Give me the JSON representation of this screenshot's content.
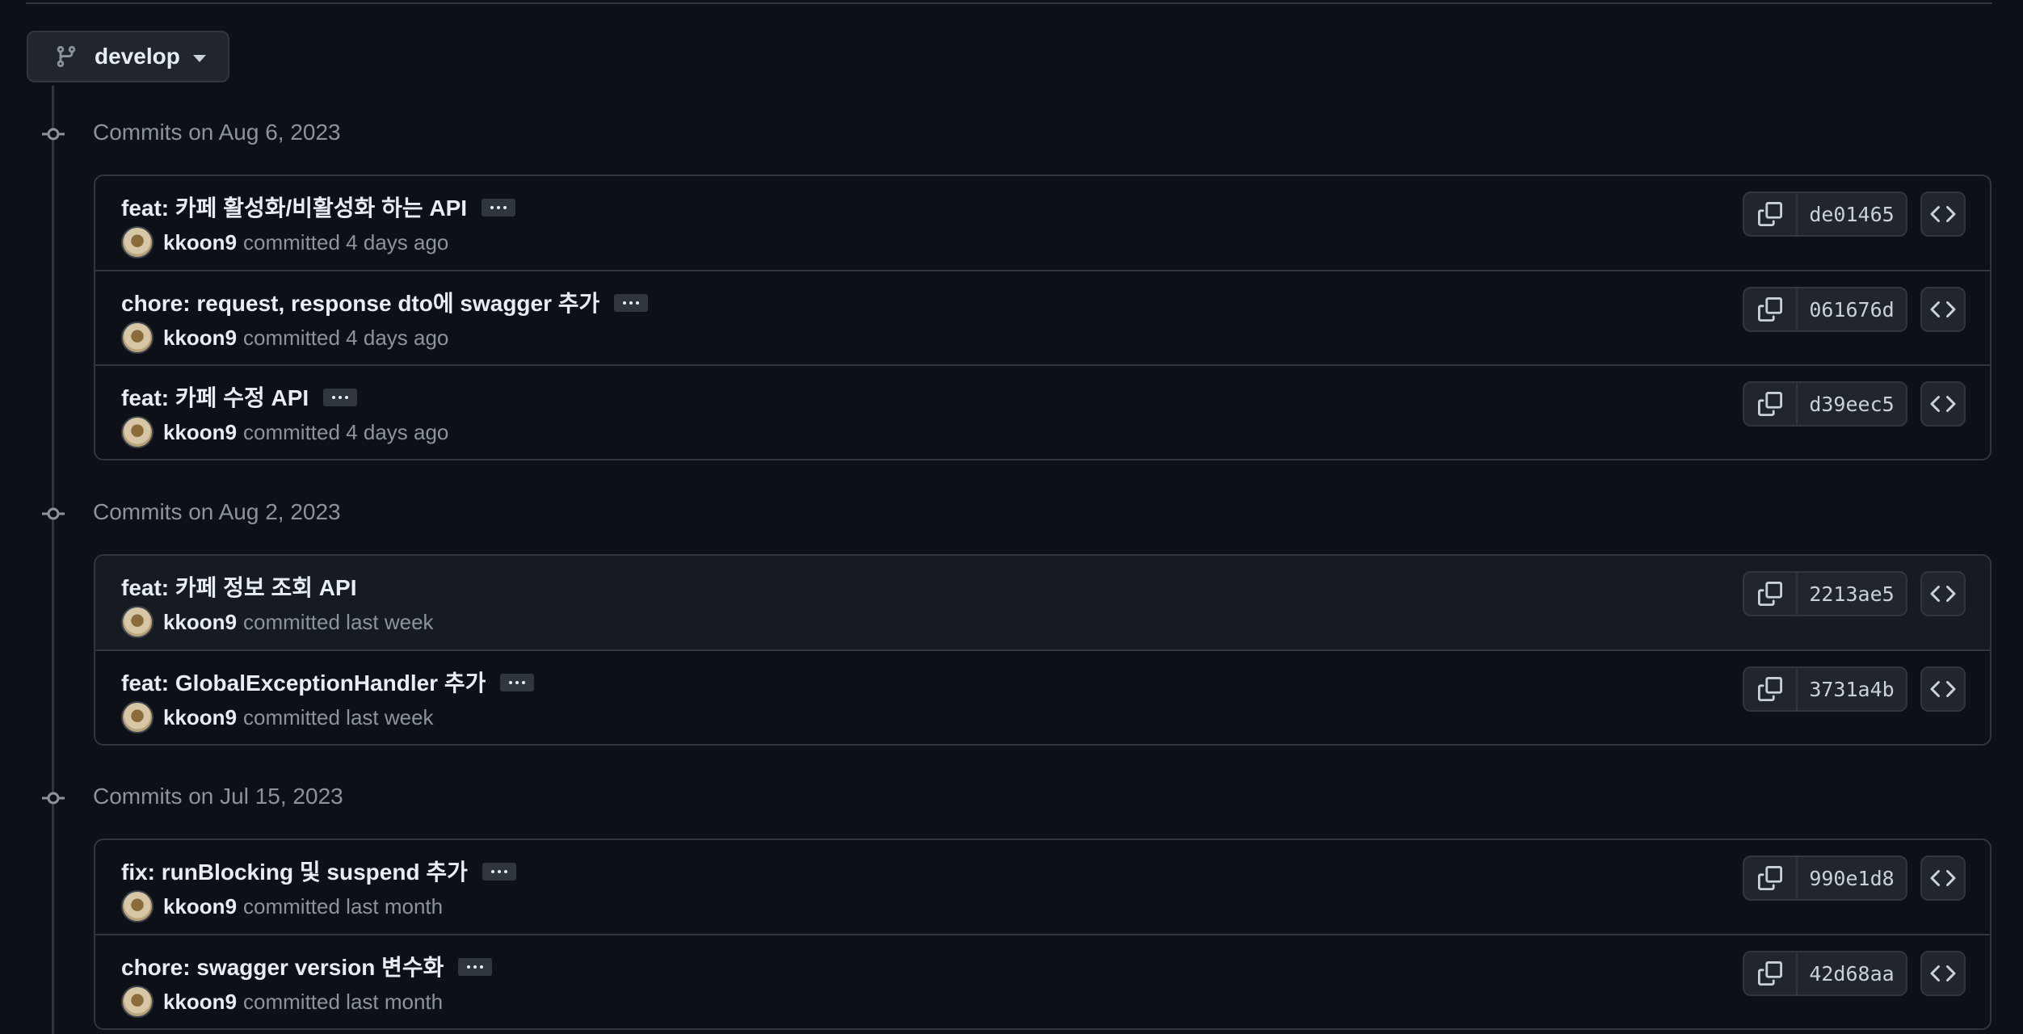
{
  "branch": {
    "name": "develop"
  },
  "groups": [
    {
      "date_label": "Commits on Aug 6, 2023",
      "commits": [
        {
          "message": "feat: 카페 활성화/비활성화 하는 API",
          "author": "kkoon9",
          "time": "committed 4 days ago",
          "sha": "de01465",
          "has_ellipsis": true
        },
        {
          "message": "chore: request, response dto에 swagger 추가",
          "author": "kkoon9",
          "time": "committed 4 days ago",
          "sha": "061676d",
          "has_ellipsis": true
        },
        {
          "message": "feat: 카페 수정 API",
          "author": "kkoon9",
          "time": "committed 4 days ago",
          "sha": "d39eec5",
          "has_ellipsis": true
        }
      ]
    },
    {
      "date_label": "Commits on Aug 2, 2023",
      "commits": [
        {
          "message": "feat: 카페 정보 조회 API",
          "author": "kkoon9",
          "time": "committed last week",
          "sha": "2213ae5",
          "has_ellipsis": false
        },
        {
          "message": "feat: GlobalExceptionHandler 추가",
          "author": "kkoon9",
          "time": "committed last week",
          "sha": "3731a4b",
          "has_ellipsis": true
        }
      ]
    },
    {
      "date_label": "Commits on Jul 15, 2023",
      "commits": [
        {
          "message": "fix: runBlocking 및 suspend 추가",
          "author": "kkoon9",
          "time": "committed last month",
          "sha": "990e1d8",
          "has_ellipsis": true
        },
        {
          "message": "chore: swagger version 변수화",
          "author": "kkoon9",
          "time": "committed last month",
          "sha": "42d68aa",
          "has_ellipsis": true
        }
      ]
    }
  ]
}
